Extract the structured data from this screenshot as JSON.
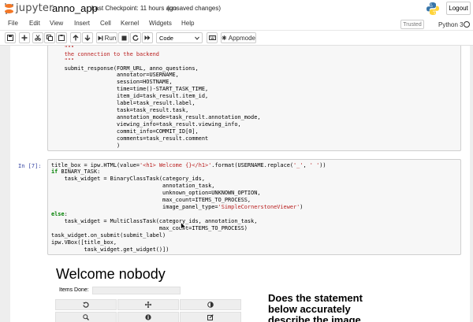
{
  "header": {
    "logo_text": "jupyter",
    "notebook_name": "anno_app",
    "checkpoint": "Last Checkpoint: 11 hours ago",
    "save_status": "(unsaved changes)",
    "logout_label": "Logout"
  },
  "menubar": {
    "items": [
      "File",
      "Edit",
      "View",
      "Insert",
      "Cell",
      "Kernel",
      "Widgets",
      "Help"
    ],
    "trusted": "Trusted",
    "kernel": "Python 3"
  },
  "toolbar": {
    "run_label": "Run",
    "cell_type": "Code",
    "appmode_label": "Appmode"
  },
  "cell1": {
    "lines": [
      "    \"\"\"",
      "    the connection to the backend",
      "    \"\"\"",
      "    submit_response(FORM_URL, anno_questions,",
      "                    annotator=USERNAME,",
      "                    session=HOSTNAME,",
      "                    time=time()-START_TASK_TIME,",
      "                    item_id=task_result.item_id,",
      "                    label=task_result.label,",
      "                    task=task_result.task,",
      "                    annotation_mode=task_result.annotation_mode,",
      "                    viewing_info=task_result.viewing_info,",
      "                    commit_info=COMMIT_ID[0],",
      "                    comments=task_result.comment",
      "                    )"
    ]
  },
  "cell2": {
    "prompt": "In [7]:",
    "line1_a": "title_box = ipw.HTML(value=",
    "line1_str": "'<h1> Welcome {}</h1>'",
    "line1_b": ".format(USERNAME.replace(",
    "line1_str2": "'_'",
    "line1_c": ", ",
    "line1_str3": "' '",
    "line1_d": "))",
    "line2_kw": "if",
    "line2": " BINARY_TASK:",
    "line3": "    task_widget = BinaryClassTask(category_ids,",
    "line4": "                                  annotation_task,",
    "line5": "                                  unknown_option=UNKNOWN_OPTION,",
    "line6": "                                  max_count=ITEMS_TO_PROCESS,",
    "line7_a": "                                  image_panel_type=",
    "line7_str": "'SimpleCornerstoneViewer'",
    "line7_b": ")",
    "line8_kw": "else",
    "line8": ":",
    "line9": "    task_widget = MultiClassTask(category_ids, annotation_task,",
    "line10": "                                 max_count=ITEMS_TO_PROCESS)",
    "line11": "task_widget.on_submit(submit_label)",
    "line12": "ipw.VBox([title_box,",
    "line13": "          task_widget.get_widget()])"
  },
  "output": {
    "welcome": "Welcome nobody",
    "items_done_label": "Items Done:",
    "items_done_progress": 0,
    "question": "Does the statement below accurately describe the image"
  },
  "colors": {
    "jupyter_orange": "#f37726",
    "keyword_green": "#008000",
    "string_red": "#ba2121",
    "prompt_blue": "#303f9f"
  }
}
